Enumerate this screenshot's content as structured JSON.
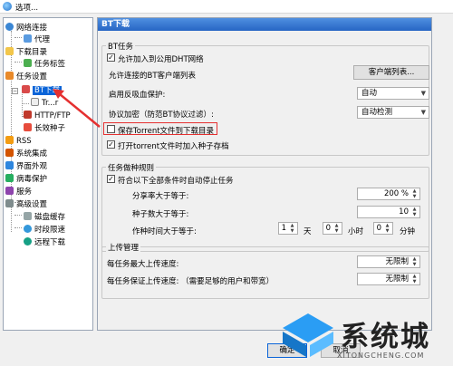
{
  "window": {
    "title": "选项..."
  },
  "tree": {
    "items": [
      {
        "label": "网络连接",
        "icon": "globe-icon"
      },
      {
        "label": "代理",
        "icon": "computer-icon"
      },
      {
        "label": "下载目录",
        "icon": "folder-icon"
      },
      {
        "label": "任务标签",
        "icon": "tag-icon"
      },
      {
        "label": "任务设置",
        "icon": "settings-icon"
      },
      {
        "label": "BT下载",
        "icon": "bt-icon",
        "selected": true
      },
      {
        "label": "Tr...r",
        "icon": "tracker-icon"
      },
      {
        "label": "HTTP/FTP",
        "icon": "http-icon"
      },
      {
        "label": "长效种子",
        "icon": "seed-icon"
      },
      {
        "label": "RSS",
        "icon": "rss-icon"
      },
      {
        "label": "系统集成",
        "icon": "puzzle-icon"
      },
      {
        "label": "界面外观",
        "icon": "palette-icon"
      },
      {
        "label": "病毒保护",
        "icon": "shield-icon"
      },
      {
        "label": "服务",
        "icon": "service-icon"
      },
      {
        "label": "高级设置",
        "icon": "advanced-icon"
      },
      {
        "label": "磁盘缓存",
        "icon": "disk-icon"
      },
      {
        "label": "时段限速",
        "icon": "clock-icon"
      },
      {
        "label": "远程下载",
        "icon": "remote-icon"
      }
    ]
  },
  "pane": {
    "header": "BT下载",
    "bt_task": {
      "legend": "BT任务",
      "dht_label": "允许加入到公用DHT网络",
      "dht_checked": true,
      "clients_label": "允许连接的BT客户端列表",
      "clients_button": "客户端列表...",
      "anti_leech_label": "启用反吸血保护:",
      "anti_leech_value": "自动",
      "encrypt_label": "协议加密（防范BT协议过滤）:",
      "encrypt_value": "自动检测",
      "save_torrent_label": "保存Torrent文件到下载目录",
      "save_torrent_checked": false,
      "open_torrent_label": "打开torrent文件时加入种子存档",
      "open_torrent_checked": true
    },
    "seeding": {
      "legend": "任务做种规则",
      "auto_stop_label": "符合以下全部条件时自动停止任务",
      "auto_stop_checked": true,
      "ratio_label": "分享率大于等于:",
      "ratio_value": "200 %",
      "seeds_label": "种子数大于等于:",
      "seeds_value": "10",
      "time_label": "作种时间大于等于:",
      "days_value": "1",
      "days_unit": "天",
      "hours_value": "0",
      "hours_unit": "小时",
      "minutes_value": "0",
      "minutes_unit": "分钟"
    },
    "upload": {
      "legend": "上传管理",
      "max_label": "每任务最大上传速度:",
      "max_value": "无限制",
      "guarantee_label": "每任务保证上传速度: （需要足够的用户和带宽）",
      "guarantee_value": "无限制"
    }
  },
  "buttons": {
    "ok": "确定",
    "cancel": "取消"
  },
  "watermark": {
    "text": "系统城",
    "url": "XITONGCHENG.COM"
  },
  "colors": {
    "accent": "#2765c4",
    "highlight": "#e53030",
    "selection": "#0a64d8"
  }
}
